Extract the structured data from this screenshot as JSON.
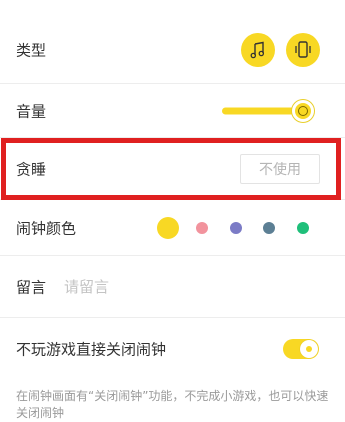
{
  "settings": {
    "type": {
      "label": "类型",
      "options": [
        {
          "name": "ringtone",
          "icon": "music-note-icon"
        },
        {
          "name": "vibrate",
          "icon": "vibrate-phone-icon"
        }
      ]
    },
    "volume": {
      "label": "音量",
      "level": 0.92
    },
    "snooze": {
      "label": "贪睡",
      "value": "不使用"
    },
    "alarm_color": {
      "label": "闹钟颜色",
      "selected": 0,
      "colors": [
        "#f8d824",
        "#f2939d",
        "#7b7bc6",
        "#5c7f94",
        "#1fbf7a"
      ]
    },
    "message": {
      "label": "留言",
      "placeholder": "请留言",
      "value": ""
    },
    "close_without_game": {
      "label": "不玩游戏直接关闭闹钟",
      "enabled": true,
      "description": "在闹钟画面有“关闭闹钟”功能，不完成小游戏，也可以快速关闭闹钟"
    }
  },
  "theme": {
    "accent": "#f8d824",
    "highlight_border": "#e02020",
    "divider": "#ededed"
  }
}
